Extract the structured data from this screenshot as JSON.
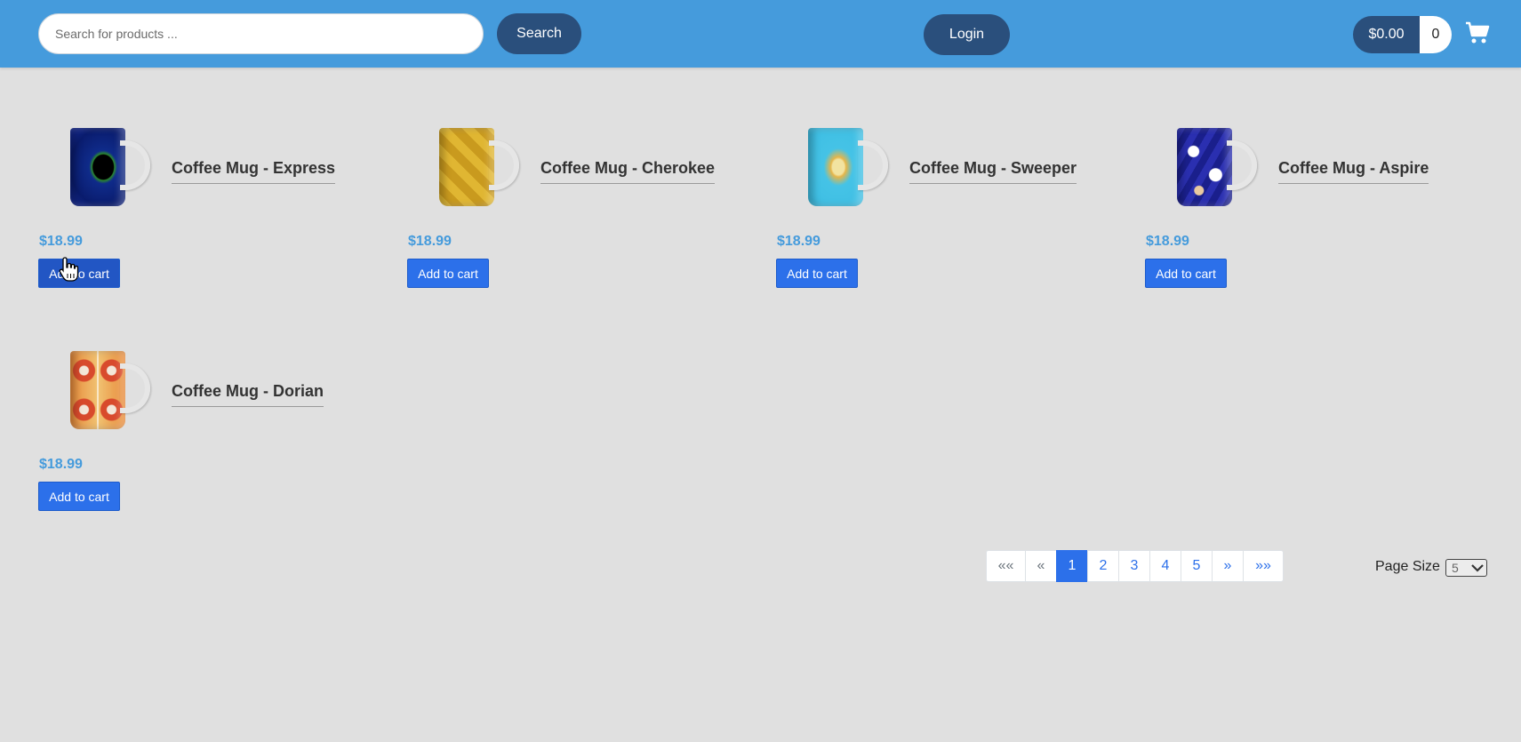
{
  "header": {
    "search_placeholder": "Search for products ...",
    "search_button": "Search",
    "login_button": "Login",
    "cart_total": "$0.00",
    "cart_count": "0",
    "cart_icon": "shopping-cart-icon"
  },
  "products": [
    {
      "title": "Coffee Mug - Express",
      "price": "$18.99",
      "add_label": "Add to cart"
    },
    {
      "title": "Coffee Mug - Cherokee",
      "price": "$18.99",
      "add_label": "Add to cart"
    },
    {
      "title": "Coffee Mug - Sweeper",
      "price": "$18.99",
      "add_label": "Add to cart"
    },
    {
      "title": "Coffee Mug - Aspire",
      "price": "$18.99",
      "add_label": "Add to cart"
    },
    {
      "title": "Coffee Mug - Dorian",
      "price": "$18.99",
      "add_label": "Add to cart"
    }
  ],
  "pagination": {
    "first": "«« ",
    "prev": "«",
    "pages": [
      "1",
      "2",
      "3",
      "4",
      "5"
    ],
    "active_page": "1",
    "next": "»",
    "last": "»»"
  },
  "page_size": {
    "label": "Page Size",
    "value": "5"
  },
  "colors": {
    "header": "#459bdc",
    "dark_button": "#2a4f7c",
    "accent": "#2c70ea",
    "background": "#e0e0e0"
  }
}
